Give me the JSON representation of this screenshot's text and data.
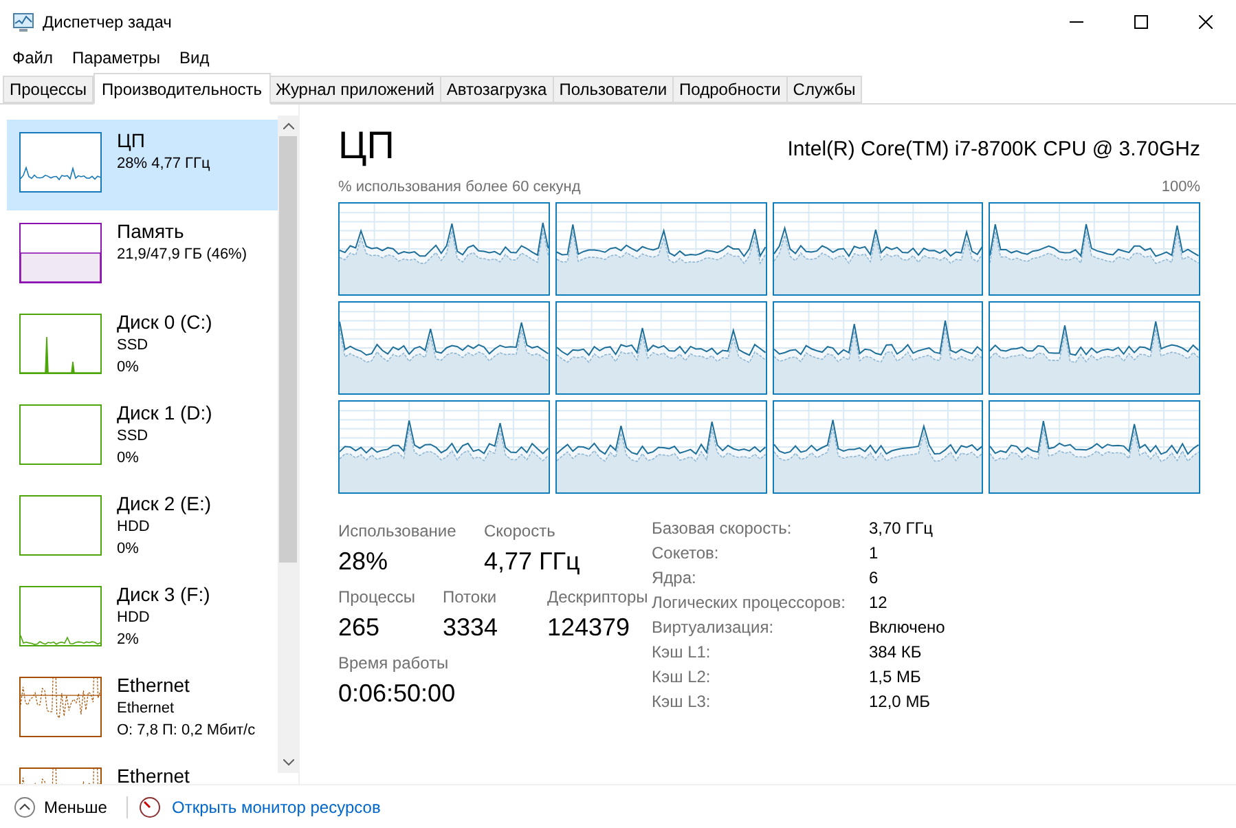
{
  "window": {
    "title": "Диспетчер задач"
  },
  "menu": [
    "Файл",
    "Параметры",
    "Вид"
  ],
  "tabs": [
    {
      "label": "Процессы",
      "selected": false
    },
    {
      "label": "Производительность",
      "selected": true
    },
    {
      "label": "Журнал приложений",
      "selected": false
    },
    {
      "label": "Автозагрузка",
      "selected": false
    },
    {
      "label": "Пользователи",
      "selected": false
    },
    {
      "label": "Подробности",
      "selected": false
    },
    {
      "label": "Службы",
      "selected": false
    }
  ],
  "sidebar": {
    "items": [
      {
        "kind": "cpu",
        "color": "#1779ba",
        "name": "ЦП",
        "lines": [
          "28% 4,77 ГГц"
        ],
        "selected": true
      },
      {
        "kind": "memory",
        "color": "#8b12ae",
        "name": "Память",
        "lines": [
          "21,9/47,9 ГБ (46%)"
        ],
        "selected": false
      },
      {
        "kind": "disk",
        "color": "#4da60c",
        "name": "Диск 0 (C:)",
        "lines": [
          "SSD",
          "0%"
        ],
        "selected": false
      },
      {
        "kind": "disk",
        "color": "#4da60c",
        "name": "Диск 1 (D:)",
        "lines": [
          "SSD",
          "0%"
        ],
        "selected": false
      },
      {
        "kind": "disk",
        "color": "#4da60c",
        "name": "Диск 2 (E:)",
        "lines": [
          "HDD",
          "0%"
        ],
        "selected": false
      },
      {
        "kind": "disk",
        "color": "#4da60c",
        "name": "Диск 3 (F:)",
        "lines": [
          "HDD",
          "2%"
        ],
        "selected": false
      },
      {
        "kind": "ethernet",
        "color": "#a74f01",
        "name": "Ethernet",
        "lines": [
          "Ethernet",
          "О: 7,8 П: 0,2 Мбит/с"
        ],
        "selected": false
      },
      {
        "kind": "ethernet",
        "color": "#a74f01",
        "name": "Ethernet",
        "selected": false
      }
    ]
  },
  "main": {
    "title": "ЦП",
    "model": "Intel(R) Core(TM) i7-8700K CPU @ 3.70GHz",
    "graph_label": "% использования более 60 секунд",
    "graph_max": "100%",
    "stats": [
      [
        {
          "label": "Использование",
          "value": "28%"
        },
        {
          "label": "Скорость",
          "value": "4,77 ГГц"
        }
      ],
      [
        {
          "label": "Процессы",
          "value": "265"
        },
        {
          "label": "Потоки",
          "value": "3334"
        },
        {
          "label": "Дескрипторы",
          "value": "124379"
        }
      ],
      [
        {
          "label": "Время работы",
          "value": "0:06:50:00"
        }
      ]
    ],
    "details": [
      {
        "label": "Базовая скорость:",
        "value": "3,70 ГГц"
      },
      {
        "label": "Сокетов:",
        "value": "1"
      },
      {
        "label": "Ядра:",
        "value": "6"
      },
      {
        "label": "Логических процессоров:",
        "value": "12"
      },
      {
        "label": "Виртуализация:",
        "value": "Включено"
      },
      {
        "label": "Кэш L1:",
        "value": "384 КБ"
      },
      {
        "label": "Кэш L2:",
        "value": "1,5 МБ"
      },
      {
        "label": "Кэш L3:",
        "value": "12,0 МБ"
      }
    ]
  },
  "footer": {
    "less": "Меньше",
    "monitor_link": "Открыть монитор ресурсов"
  }
}
